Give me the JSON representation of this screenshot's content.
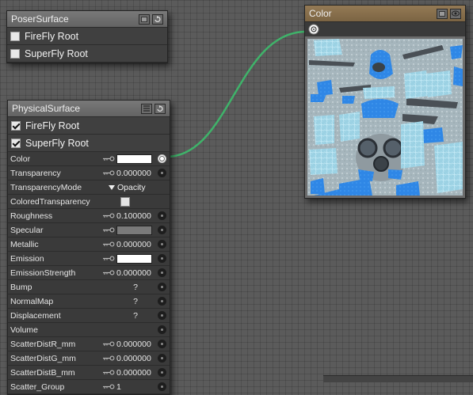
{
  "colors": {
    "wire": "#3fb36a",
    "color_node_header": "#8a7150",
    "uv_blue": "#3a8fe6"
  },
  "poser_surface": {
    "title": "PoserSurface",
    "roots": [
      {
        "label": "FireFly Root",
        "checked": false
      },
      {
        "label": "SuperFly Root",
        "checked": false
      }
    ]
  },
  "physical_surface": {
    "title": "PhysicalSurface",
    "roots": [
      {
        "label": "FireFly Root",
        "checked": true
      },
      {
        "label": "SuperFly Root",
        "checked": true
      }
    ],
    "props": [
      {
        "label": "Color",
        "kind": "swatch",
        "swatch": "#ffffff",
        "key": true,
        "socket": "out"
      },
      {
        "label": "Transparency",
        "kind": "value",
        "value": "0.000000",
        "key": true
      },
      {
        "label": "TransparencyMode",
        "kind": "dropdown",
        "value": "Opacity"
      },
      {
        "label": "ColoredTransparency",
        "kind": "checkbox"
      },
      {
        "label": "Roughness",
        "kind": "value",
        "value": "0.100000",
        "key": true
      },
      {
        "label": "Specular",
        "kind": "swatch",
        "swatch": "#7a7a7a",
        "key": true
      },
      {
        "label": "Metallic",
        "kind": "value",
        "value": "0.000000",
        "key": true
      },
      {
        "label": "Emission",
        "kind": "swatch",
        "swatch": "#ffffff",
        "key": true
      },
      {
        "label": "EmissionStrength",
        "kind": "value",
        "value": "0.000000",
        "key": true
      },
      {
        "label": "Bump",
        "kind": "q",
        "value": "?"
      },
      {
        "label": "NormalMap",
        "kind": "q",
        "value": "?"
      },
      {
        "label": "Displacement",
        "kind": "q",
        "value": "?"
      },
      {
        "label": "Volume",
        "kind": "empty"
      },
      {
        "label": "ScatterDistR_mm",
        "kind": "value",
        "value": "0.000000",
        "key": true
      },
      {
        "label": "ScatterDistG_mm",
        "kind": "value",
        "value": "0.000000",
        "key": true
      },
      {
        "label": "ScatterDistB_mm",
        "kind": "value",
        "value": "0.000000",
        "key": true
      },
      {
        "label": "Scatter_Group",
        "kind": "value",
        "value": "1",
        "key": true
      }
    ]
  },
  "color_node": {
    "title": "Color"
  }
}
